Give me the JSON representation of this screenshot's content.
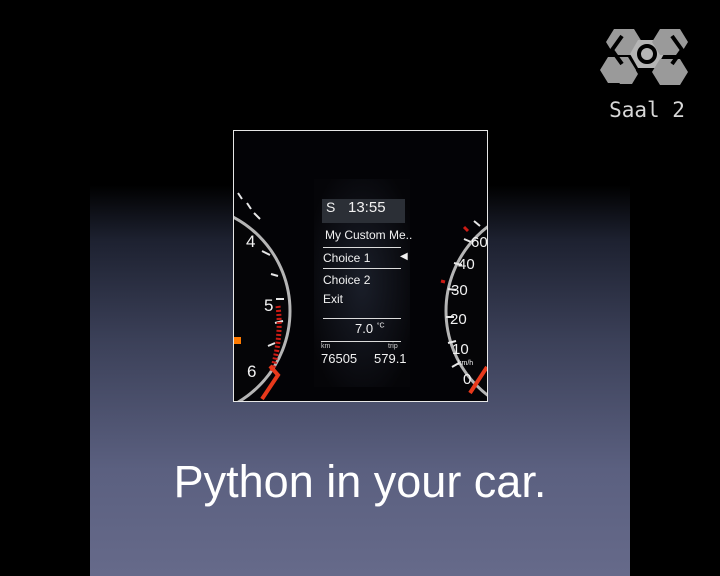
{
  "logo": {
    "icon": "congress-logo-icon",
    "room_label": "Saal 2"
  },
  "slide": {
    "caption": "Python in your car."
  },
  "dashboard": {
    "gear": "S",
    "clock": "13:55",
    "menu_title": "My Custom Me..",
    "menu_items": [
      "Choice 1",
      "Choice 2",
      "Exit"
    ],
    "temperature": "7.0",
    "temperature_unit": "°C",
    "odometer_label": "km",
    "odometer": "76505",
    "trip_label": "trip",
    "trip": "579.1",
    "tach_labels": [
      "4",
      "5",
      "6"
    ],
    "speed_labels": [
      "60",
      "40",
      "30",
      "20",
      "10",
      "0"
    ],
    "speed_unit": "km/h",
    "colors": {
      "needle": "#e8391b",
      "warning_light": "#ff7a00",
      "redline": "#cc1b14"
    }
  }
}
